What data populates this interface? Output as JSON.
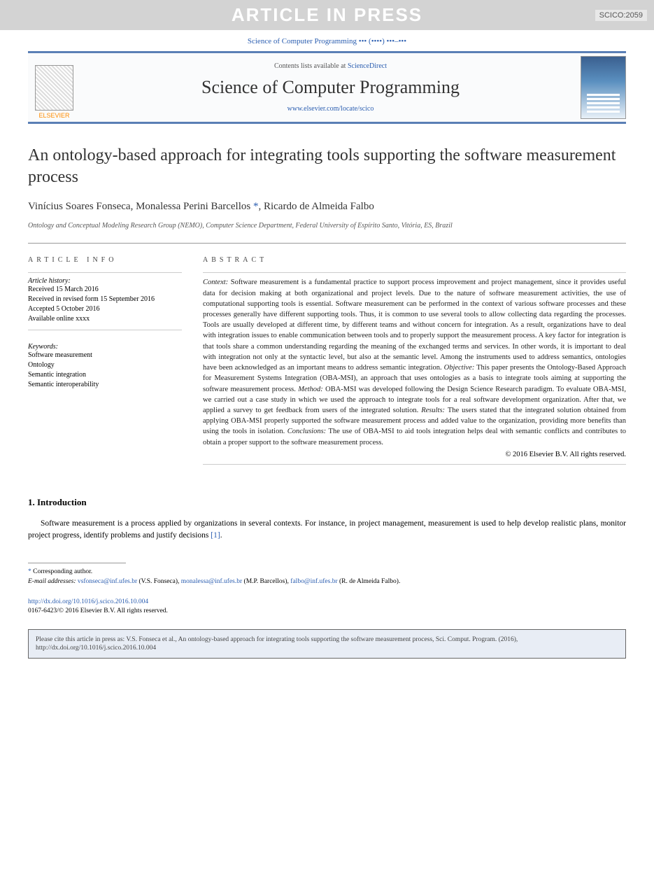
{
  "banner": {
    "text": "ARTICLE IN PRESS",
    "tag": "SCICO:2059"
  },
  "journalRef": "Science of Computer Programming ••• (••••) •••–•••",
  "header": {
    "contentsPrefix": "Contents lists available at ",
    "contentsLink": "ScienceDirect",
    "journal": "Science of Computer Programming",
    "url": "www.elsevier.com/locate/scico",
    "elsevier": "ELSEVIER"
  },
  "title": "An ontology-based approach for integrating tools supporting the software measurement process",
  "authors": {
    "a1": "Vinícius Soares Fonseca",
    "a2": "Monalessa Perini Barcellos",
    "a3": "Ricardo de Almeida Falbo"
  },
  "affiliation": "Ontology and Conceptual Modeling Research Group (NEMO), Computer Science Department, Federal University of Espírito Santo, Vitória, ES, Brazil",
  "info": {
    "label": "ARTICLE INFO",
    "historyLabel": "Article history:",
    "received": "Received 15 March 2016",
    "revised": "Received in revised form 15 September 2016",
    "accepted": "Accepted 5 October 2016",
    "online": "Available online xxxx",
    "keywordsLabel": "Keywords:",
    "keywords": [
      "Software measurement",
      "Ontology",
      "Semantic integration",
      "Semantic interoperability"
    ]
  },
  "abstract": {
    "label": "ABSTRACT",
    "labels": {
      "context": "Context:",
      "objective": "Objective:",
      "method": "Method:",
      "results": "Results:",
      "conclusions": "Conclusions:"
    },
    "context": " Software measurement is a fundamental practice to support process improvement and project management, since it provides useful data for decision making at both organizational and project levels. Due to the nature of software measurement activities, the use of computational supporting tools is essential. Software measurement can be performed in the context of various software processes and these processes generally have different supporting tools. Thus, it is common to use several tools to allow collecting data regarding the processes. Tools are usually developed at different time, by different teams and without concern for integration. As a result, organizations have to deal with integration issues to enable communication between tools and to properly support the measurement process. A key factor for integration is that tools share a common understanding regarding the meaning of the exchanged terms and services. In other words, it is important to deal with integration not only at the syntactic level, but also at the semantic level. Among the instruments used to address semantics, ontologies have been acknowledged as an important means to address semantic integration. ",
    "objective": " This paper presents the Ontology-Based Approach for Measurement Systems Integration (OBA-MSI), an approach that uses ontologies as a basis to integrate tools aiming at supporting the software measurement process. ",
    "method": " OBA-MSI was developed following the Design Science Research paradigm. To evaluate OBA-MSI, we carried out a case study in which we used the approach to integrate tools for a real software development organization. After that, we applied a survey to get feedback from users of the integrated solution. ",
    "results": " The users stated that the integrated solution obtained from applying OBA-MSI properly supported the software measurement process and added value to the organization, providing more benefits than using the tools in isolation. ",
    "conclusions": " The use of OBA-MSI to aid tools integration helps deal with semantic conflicts and contributes to obtain a proper support to the software measurement process.",
    "copyright": "© 2016 Elsevier B.V. All rights reserved."
  },
  "intro": {
    "heading": "1. Introduction",
    "p1a": "Software measurement is a process applied by organizations in several contexts. For instance, in project management, measurement is used to help develop realistic plans, monitor project progress, identify problems and justify decisions ",
    "ref1": "[1]",
    "p1b": "."
  },
  "footnotes": {
    "corr": "Corresponding author.",
    "emailLabel": "E-mail addresses: ",
    "e1": "vsfonseca@inf.ufes.br",
    "n1": " (V.S. Fonseca), ",
    "e2": "monalessa@inf.ufes.br",
    "n2": " (M.P. Barcellos), ",
    "e3": "falbo@inf.ufes.br",
    "n3": " (R. de Almeida Falbo)."
  },
  "doi": {
    "url": "http://dx.doi.org/10.1016/j.scico.2016.10.004",
    "line": "0167-6423/© 2016 Elsevier B.V. All rights reserved."
  },
  "citeBox": "Please cite this article in press as: V.S. Fonseca et al., An ontology-based approach for integrating tools supporting the software measurement process, Sci. Comput. Program. (2016), http://dx.doi.org/10.1016/j.scico.2016.10.004"
}
